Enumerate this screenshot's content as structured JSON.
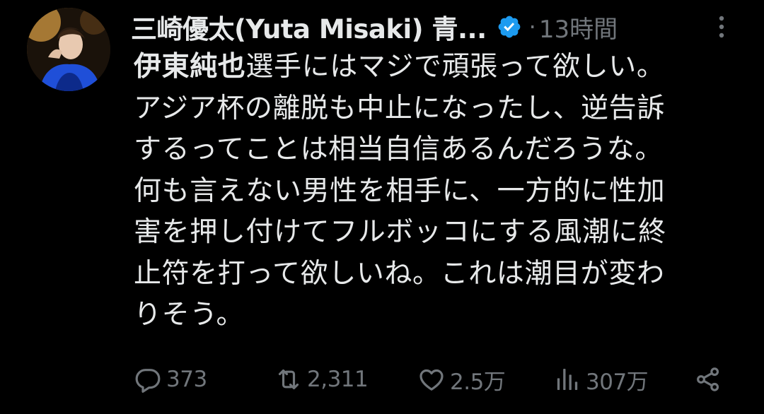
{
  "tweet": {
    "author": {
      "display_name": "三崎優太(Yuta Misaki) 青...",
      "verified": true
    },
    "separator": "·",
    "timestamp": "13時間",
    "text": {
      "mention": "伊東純也",
      "lines": [
        "選手にはマジで頑張って欲しい。",
        "アジア杯の離脱も中止になったし、逆告訴",
        "するってことは相当自信あるんだろうな。",
        "何も言えない男性を相手に、一方的に性加",
        "害を押し付けてフルボッコにする風潮に終",
        "止符を打って欲しいね。これは潮目が変わ",
        "りそう。"
      ]
    },
    "stats": {
      "replies": "373",
      "retweets": "2,311",
      "likes": "2.5万",
      "views": "307万"
    }
  },
  "colors": {
    "background": "#000000",
    "text": "#e7e9ea",
    "secondary": "#71767b",
    "verified": "#1d9bf0"
  }
}
